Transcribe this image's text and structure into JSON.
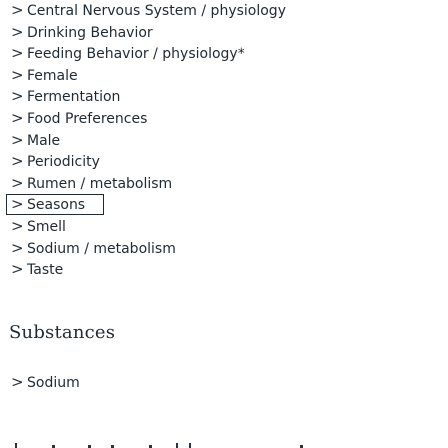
{
  "mesh_terms": [
    {
      "label": "Central Nervous System / physiology"
    },
    {
      "label": "Drinking Behavior"
    },
    {
      "label": "Feeding Behavior / physiology*"
    },
    {
      "label": "Female"
    },
    {
      "label": "Fermentation"
    },
    {
      "label": "Food Preferences"
    },
    {
      "label": "Male"
    },
    {
      "label": "Periodicity"
    },
    {
      "label": "Rumen / metabolism"
    },
    {
      "label": "Seasons",
      "focused": true
    },
    {
      "label": "Smell"
    },
    {
      "label": "Sodium / metabolism"
    },
    {
      "label": "Taste"
    }
  ],
  "substances": {
    "title": "Substances",
    "items": [
      {
        "label": "Sodium"
      }
    ]
  },
  "chevron": ">"
}
